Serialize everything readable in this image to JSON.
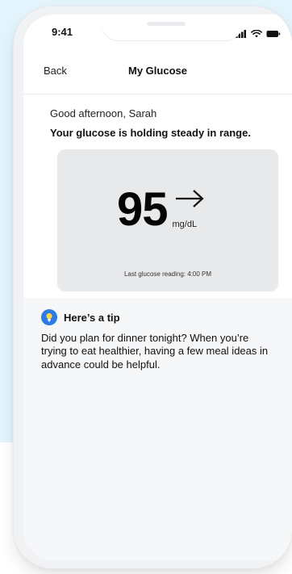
{
  "status_bar": {
    "time": "9:41"
  },
  "header": {
    "back_label": "Back",
    "title": "My Glucose"
  },
  "greeting": "Good afternoon, Sarah",
  "status_message": "Your glucose is holding steady in range.",
  "glucose": {
    "value": "95",
    "unit": "mg/dL",
    "trend": "arrow-right-icon",
    "last_reading": "Last glucose reading: 4:00 PM"
  },
  "tip": {
    "icon": "lightbulb-icon",
    "title": "Here’s a tip",
    "body": "Did you plan for dinner tonight? When you’re trying to eat healthier, having a few meal ideas in advance could be helpful."
  },
  "colors": {
    "background_blue": "#e3f4fc",
    "tip_icon_blue": "#2c7be5",
    "card_gray": "#e8e9eb"
  }
}
